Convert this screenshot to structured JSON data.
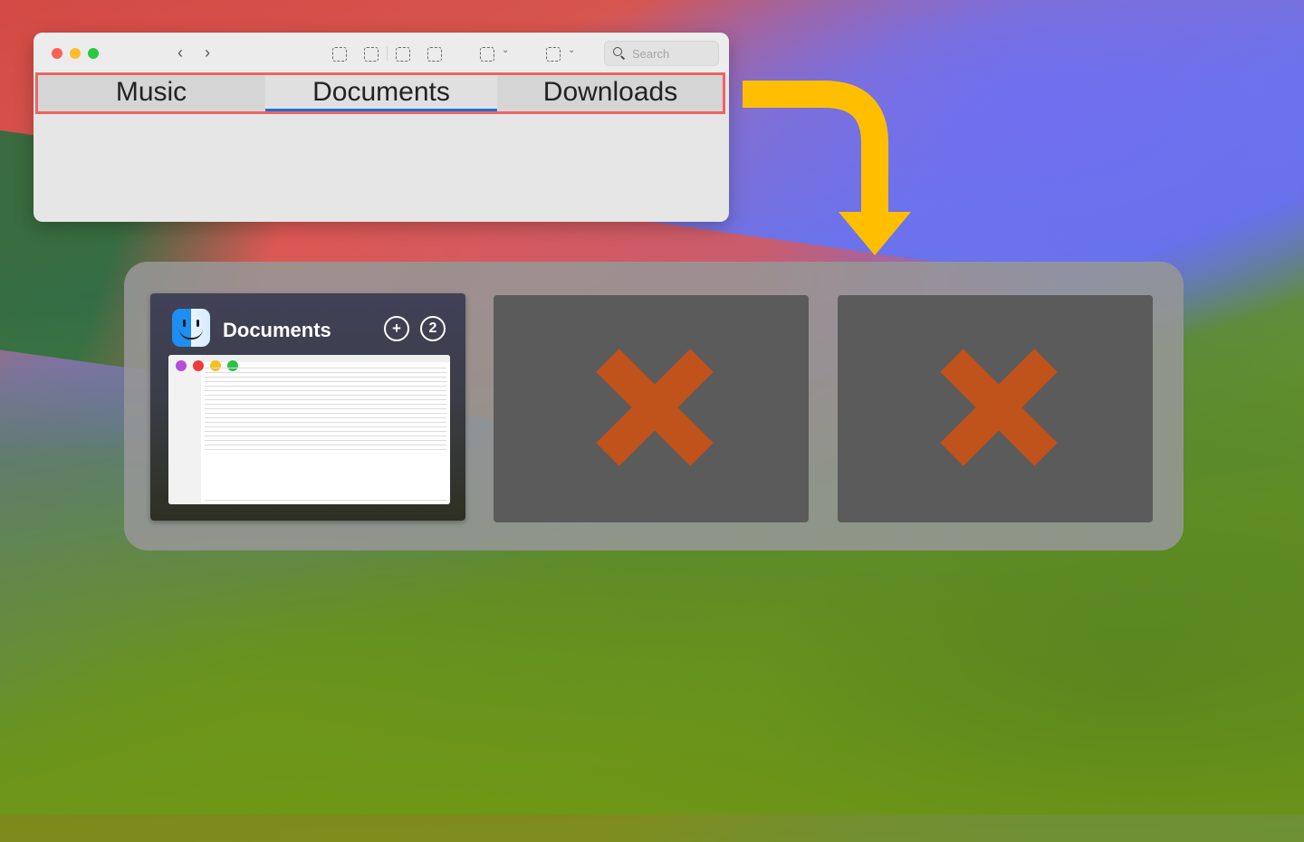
{
  "window": {
    "search_placeholder": "Search",
    "tabs": [
      {
        "label": "Music",
        "active": false
      },
      {
        "label": "Documents",
        "active": true
      },
      {
        "label": "Downloads",
        "active": false
      }
    ]
  },
  "switcher": {
    "slots": [
      {
        "title": "Documents",
        "count": "2",
        "status": "window-preview"
      },
      {
        "status": "empty"
      },
      {
        "status": "empty"
      }
    ]
  },
  "colors": {
    "highlight_border": "#ec6461",
    "active_tab_underline": "#1f6fd6",
    "arrow": "#ffbf00",
    "x_mark": "#c0521c"
  }
}
